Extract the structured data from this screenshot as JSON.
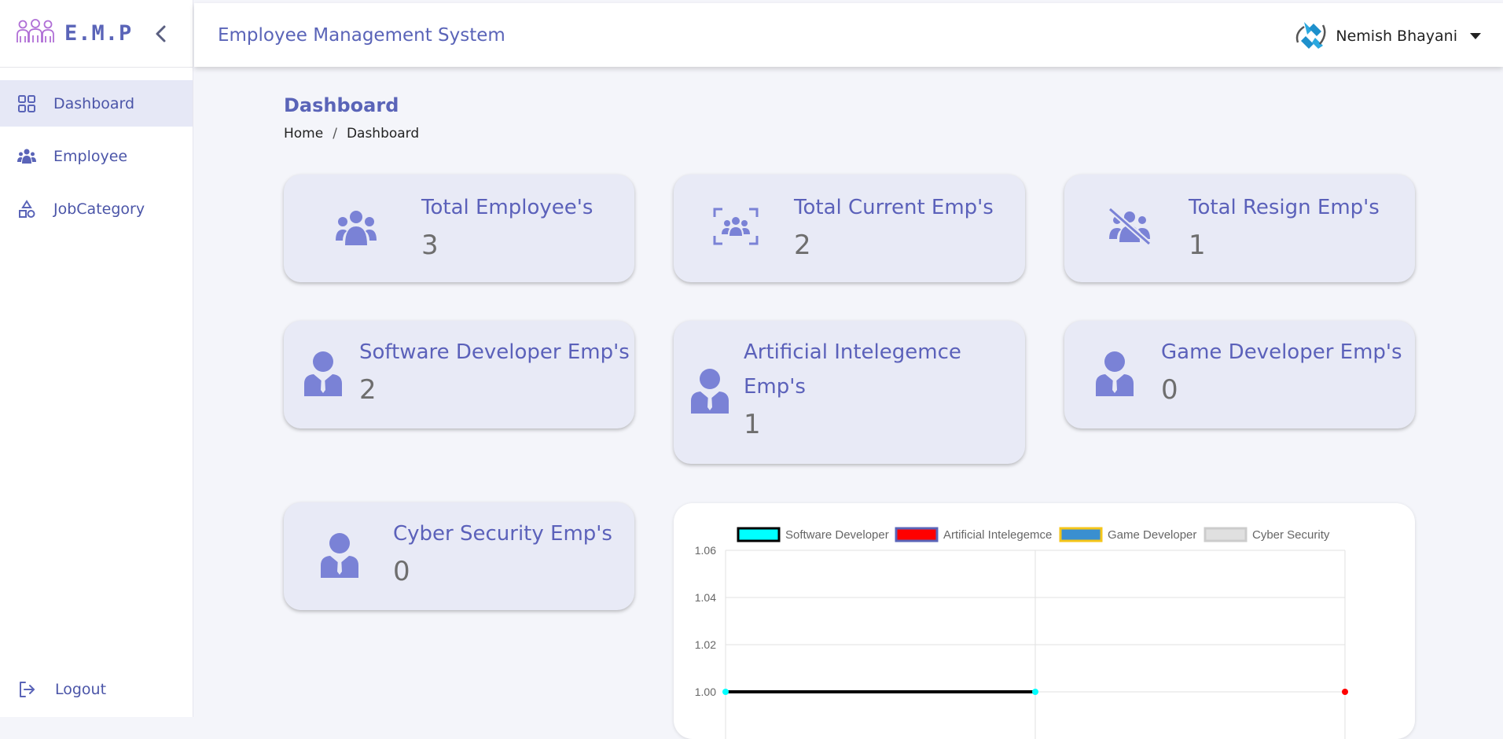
{
  "sidebar": {
    "brand": "E.M.P",
    "items": [
      {
        "label": "Dashboard",
        "icon": "grid-icon",
        "active": true
      },
      {
        "label": "Employee",
        "icon": "users-icon",
        "active": false
      },
      {
        "label": "JobCategory",
        "icon": "shapes-icon",
        "active": false
      }
    ],
    "logout_label": "Logout"
  },
  "header": {
    "title": "Employee Management System",
    "user_name": "Nemish Bhayani"
  },
  "page": {
    "title": "Dashboard",
    "breadcrumb": [
      "Home",
      "Dashboard"
    ]
  },
  "cards": [
    {
      "title": "Total Employee's",
      "value": "3",
      "icon": "users-group-icon"
    },
    {
      "title": "Total Current Emp's",
      "value": "2",
      "icon": "users-focus-icon"
    },
    {
      "title": "Total Resign Emp's",
      "value": "1",
      "icon": "users-slash-icon"
    },
    {
      "title": "Software Developer Emp's",
      "value": "2",
      "icon": "user-tie-icon"
    },
    {
      "title": "Artificial Intelegemce Emp's",
      "value": "1",
      "icon": "user-tie-icon"
    },
    {
      "title": "Game Developer Emp's",
      "value": "0",
      "icon": "user-tie-icon"
    },
    {
      "title": "Cyber Security Emp's",
      "value": "0",
      "icon": "user-tie-icon"
    }
  ],
  "colors": {
    "accent": "#5a64b8",
    "card_bg": "#e8eaf6",
    "page_bg": "#f4f5fa"
  },
  "chart_data": {
    "type": "line",
    "x": [
      0,
      1,
      2
    ],
    "series": [
      {
        "name": "Software Developer",
        "values": [
          1,
          1,
          null
        ],
        "color": "#00ffff",
        "border": "#000000"
      },
      {
        "name": "Artificial Intelegemce",
        "values": [
          null,
          null,
          1
        ],
        "color": "#ff0000",
        "border": "#5a64b8"
      },
      {
        "name": "Game Developer",
        "values": [],
        "color": "#3a8fd0",
        "border": "#f5c518"
      },
      {
        "name": "Cyber Security",
        "values": [],
        "color": "#e0e0e0",
        "border": "#cccccc"
      }
    ],
    "y_ticks": [
      "1.06",
      "1.04",
      "1.02",
      "1.00"
    ],
    "ylim": [
      1.0,
      1.06
    ],
    "legend": "top",
    "grid": true
  }
}
